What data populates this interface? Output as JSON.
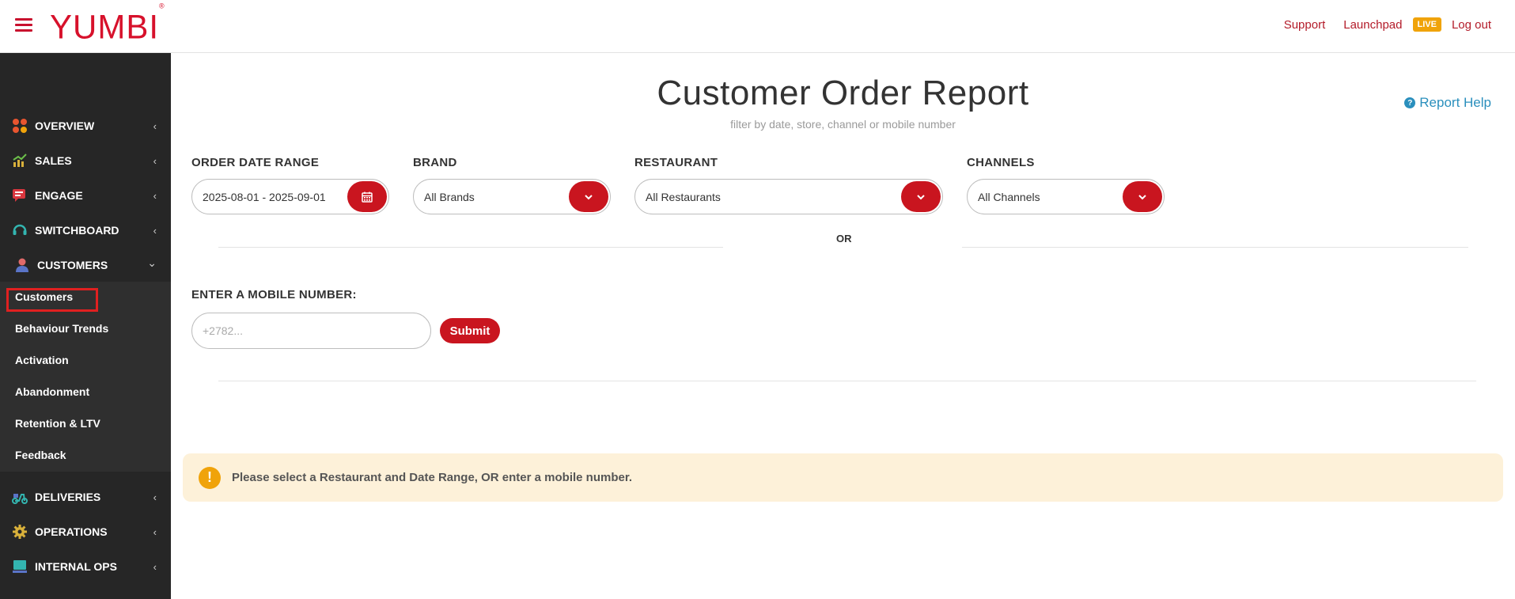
{
  "header": {
    "logo": "YUMBI",
    "logo_mark": "®",
    "links": {
      "support": "Support",
      "launchpad": "Launchpad",
      "live": "LIVE",
      "logout": "Log out"
    }
  },
  "sidebar": {
    "items": [
      {
        "label": "OVERVIEW",
        "icon": "overview-icon"
      },
      {
        "label": "SALES",
        "icon": "sales-chart-icon"
      },
      {
        "label": "ENGAGE",
        "icon": "engage-chat-icon"
      },
      {
        "label": "SWITCHBOARD",
        "icon": "headset-icon"
      },
      {
        "label": "CUSTOMERS",
        "icon": "customer-icon"
      },
      {
        "label": "DELIVERIES",
        "icon": "scooter-icon"
      },
      {
        "label": "OPERATIONS",
        "icon": "gear-icon"
      },
      {
        "label": "INTERNAL OPS",
        "icon": "monitor-icon"
      }
    ],
    "customers_submenu": [
      "Customers",
      "Behaviour Trends",
      "Activation",
      "Abandonment",
      "Retention & LTV",
      "Feedback"
    ],
    "chevron_collapsed": "‹",
    "chevron_expanded": "⌄"
  },
  "main": {
    "title": "Customer Order Report",
    "subtitle": "filter by date, store, channel or mobile number",
    "help": "Report Help",
    "filters": {
      "date_label": "ORDER DATE RANGE",
      "date_value": "2025-08-01 - 2025-09-01",
      "brand_label": "BRAND",
      "brand_value": "All Brands",
      "restaurant_label": "RESTAURANT",
      "restaurant_value": "All Restaurants",
      "channels_label": "CHANNELS",
      "channels_value": "All Channels"
    },
    "or_text": "OR",
    "mobile_label": "ENTER A MOBILE NUMBER:",
    "mobile_placeholder": "+2782...",
    "submit": "Submit",
    "alert": "Please select a Restaurant and Date Range, OR enter a mobile number.",
    "alert_icon": "!"
  },
  "colors": {
    "brand_red": "#d7112b",
    "button_red": "#c9151f",
    "sidebar_bg": "#262626",
    "alert_bg": "#fdf1d9",
    "live": "#f0a30a",
    "link_blue": "#2a8fbd"
  }
}
